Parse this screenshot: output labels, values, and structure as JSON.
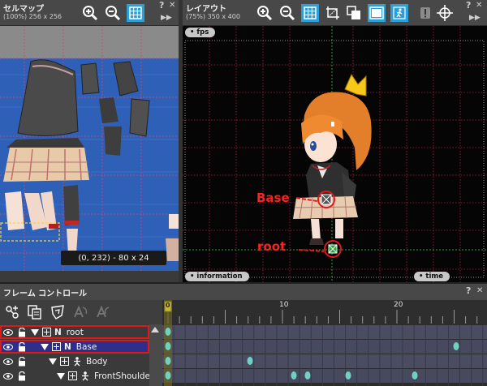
{
  "cellmap": {
    "title": "セルマップ",
    "subtitle": "(100%) 256 x 256",
    "coord_readout": "(0, 232) - 80 x 24",
    "help": "?",
    "close": "✕",
    "more": "▶▶"
  },
  "layout": {
    "title": "レイアウト",
    "subtitle": "(75%) 350 x 400",
    "fps_label": "fps",
    "information_label": "information",
    "time_label": "time",
    "base_label": "Base",
    "root_label": "root",
    "help": "?",
    "close": "✕",
    "more": "▶▶"
  },
  "frame_control": {
    "title": "フレーム コントロール",
    "help": "?",
    "close": "✕",
    "ruler": {
      "current_frame": "0",
      "mark_10": "10",
      "mark_20": "20"
    },
    "rows": [
      {
        "type": "N",
        "label": "root"
      },
      {
        "type": "N",
        "label": "Base"
      },
      {
        "type": "figure",
        "label": "Body"
      },
      {
        "type": "figure",
        "label": "FrontShoulder"
      }
    ]
  },
  "colors": {
    "accent": "#2a9fd8",
    "annotation_red": "#ff2020",
    "keyframe": "#6fd1c0",
    "selection": "#2d2f8a"
  }
}
